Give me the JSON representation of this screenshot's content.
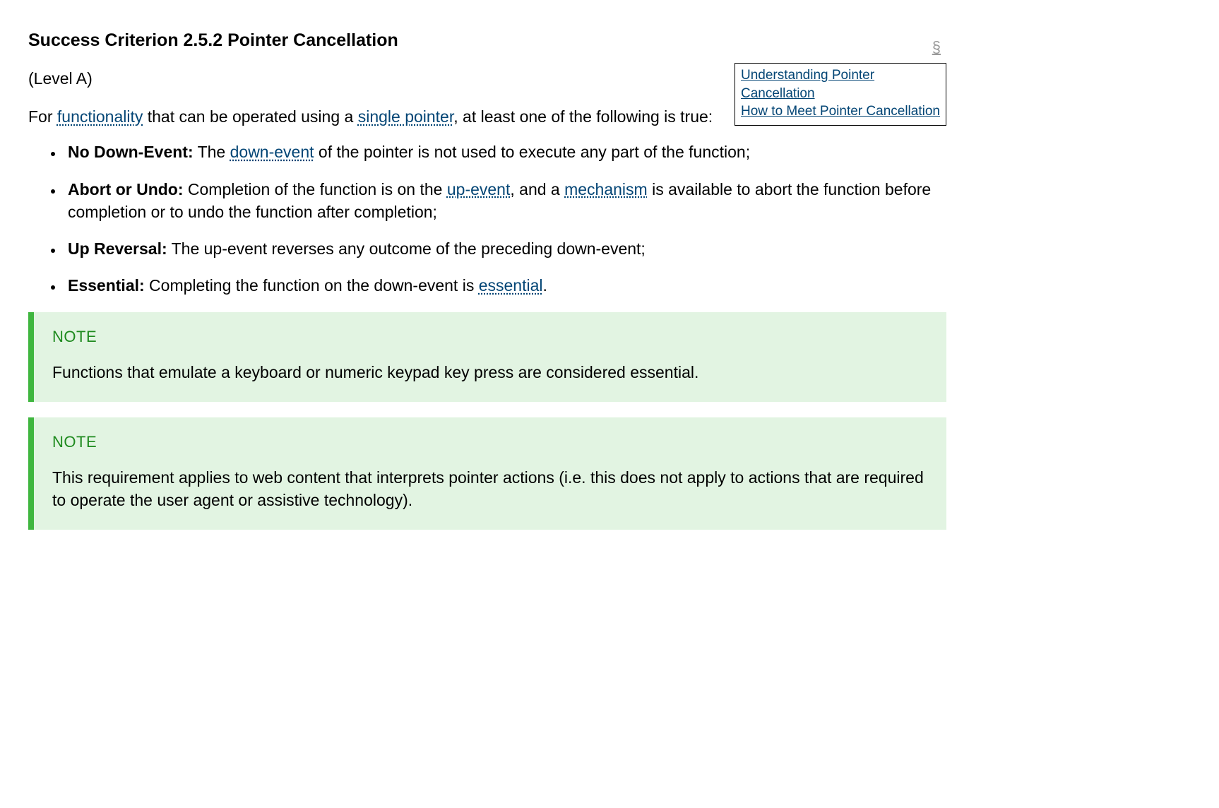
{
  "heading": "Success Criterion 2.5.2 Pointer Cancellation",
  "section_mark": "§",
  "level": "(Level A)",
  "doclinks": {
    "understanding": "Understanding Pointer Cancellation",
    "howto": "How to Meet Pointer Cancellation"
  },
  "intro": {
    "pre": "For ",
    "term1": "functionality",
    "mid1": " that can be operated using a ",
    "term2": "single pointer",
    "post": ", at least one of the following is true:"
  },
  "items": [
    {
      "term": "No Down-Event:",
      "pre": "  The ",
      "link": "down-event",
      "post": " of the pointer is not used to execute any part of the function;"
    },
    {
      "term": "Abort or Undo:",
      "pre": "  Completion of the function is on the ",
      "link": "up-event",
      "mid": ", and a ",
      "link2": "mechanism",
      "post": " is available to abort the function before completion or to undo the function after completion;"
    },
    {
      "term": "Up Reversal:",
      "post": "  The up-event reverses any outcome of the preceding down-event;"
    },
    {
      "term": "Essential:",
      "pre": "  Completing the function on the down-event is ",
      "link": "essential",
      "post": "."
    }
  ],
  "notes": [
    {
      "label": "NOTE",
      "body": "Functions that emulate a keyboard or numeric keypad key press are considered essential."
    },
    {
      "label": "NOTE",
      "body": "This requirement applies to web content that interprets pointer actions (i.e. this does not apply to actions that are required to operate the user agent or assistive technology)."
    }
  ]
}
